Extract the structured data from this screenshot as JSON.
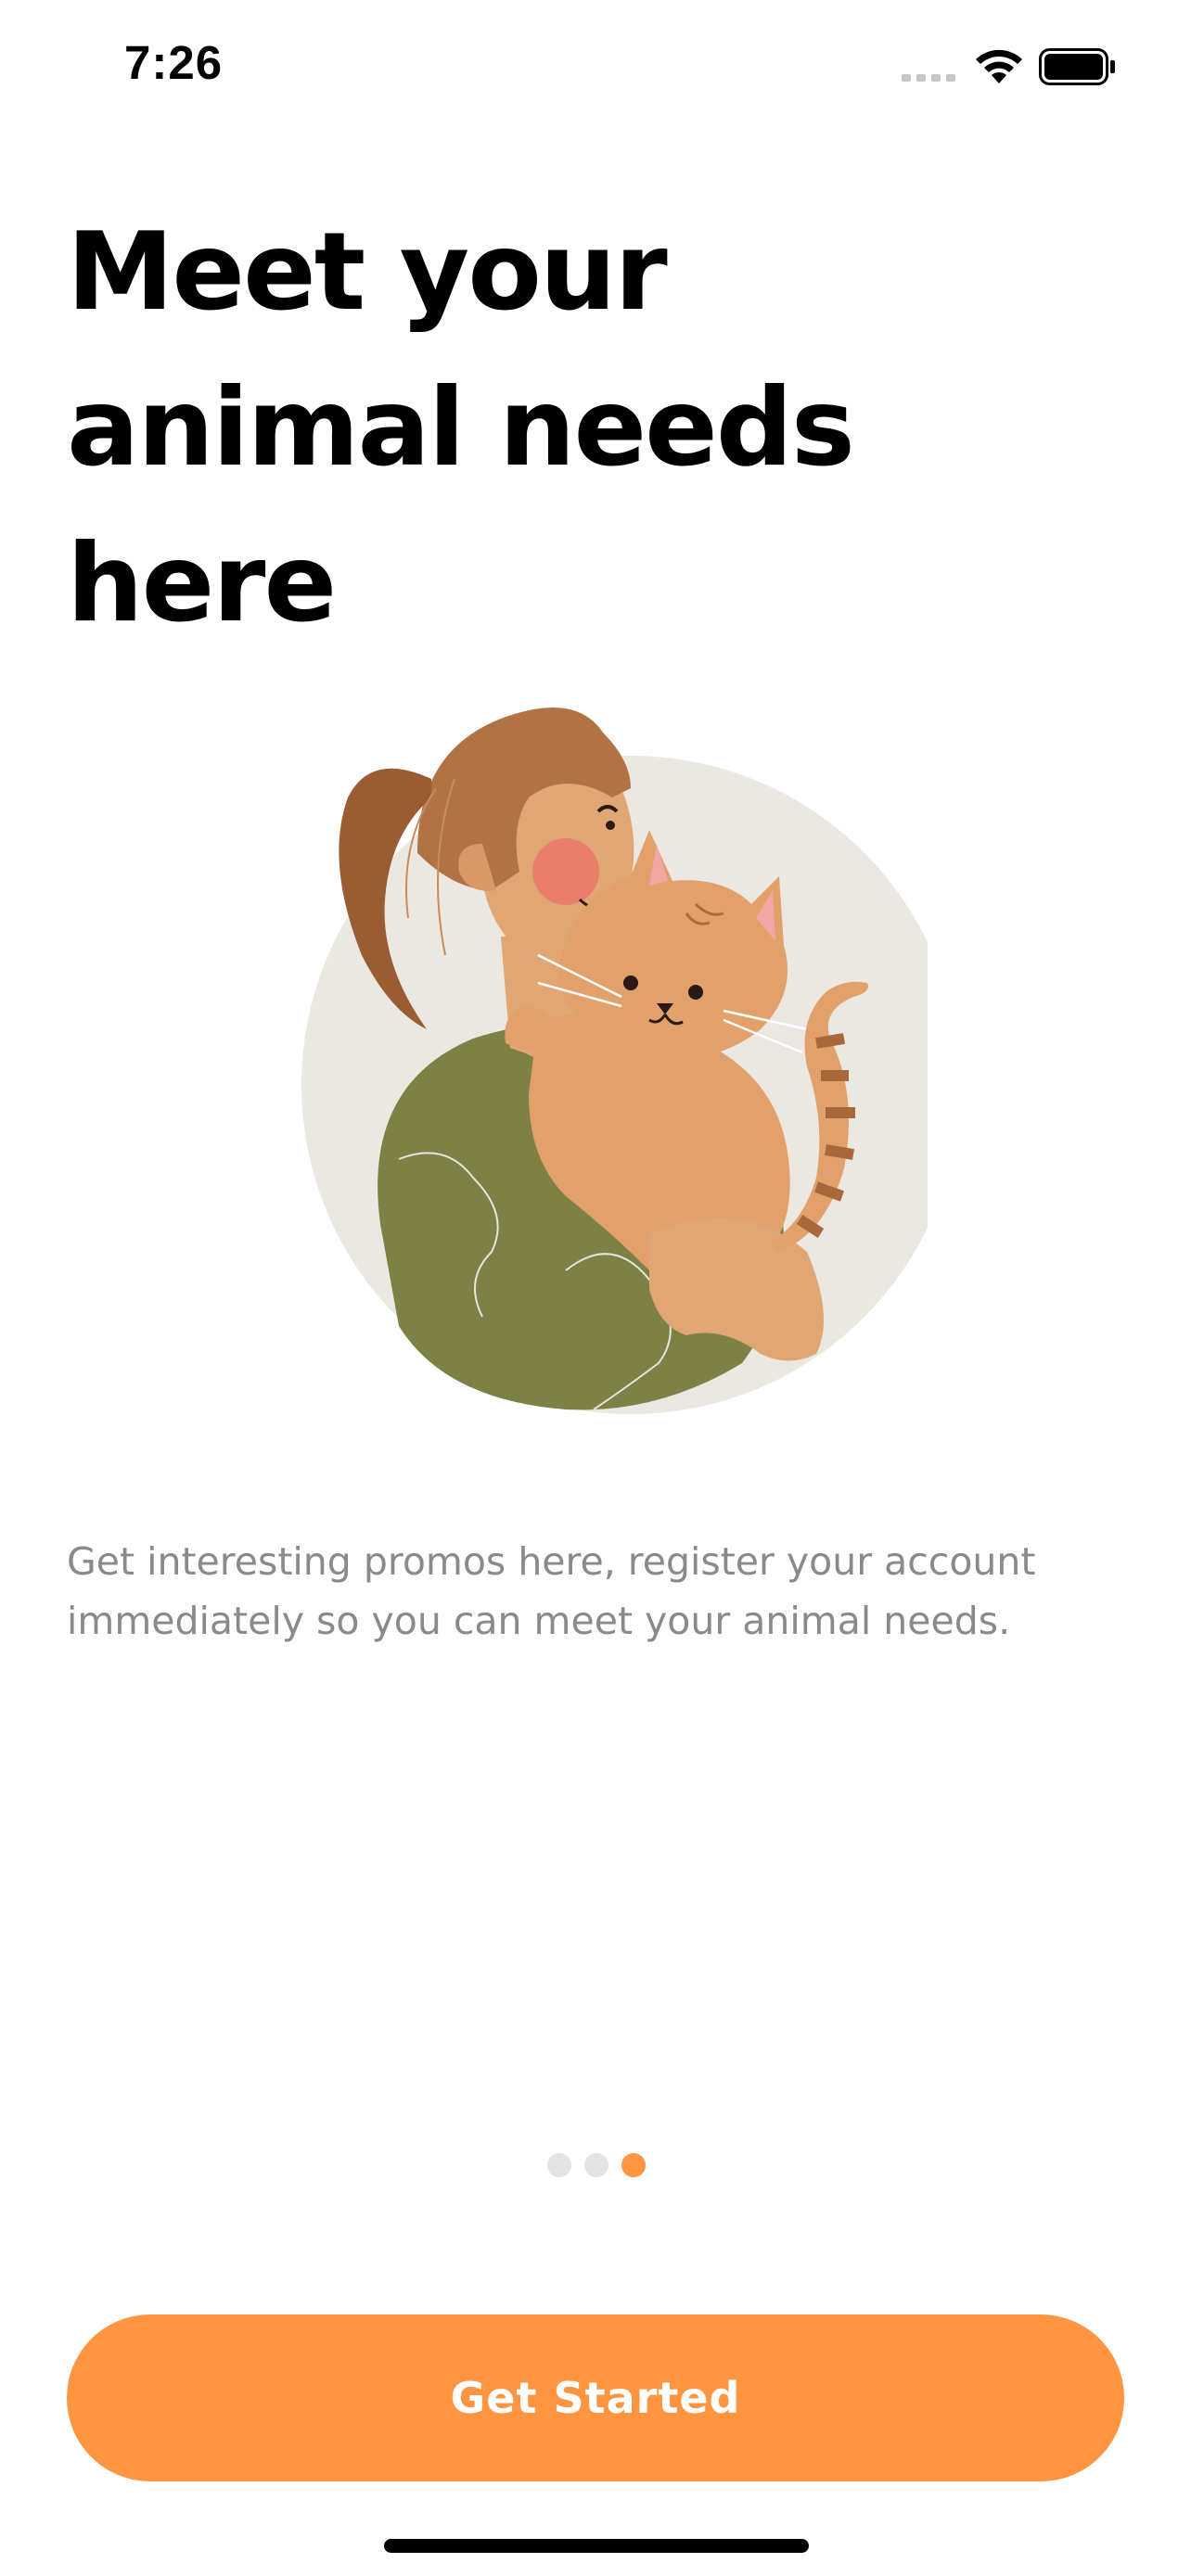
{
  "status_bar": {
    "time": "7:26"
  },
  "onboarding": {
    "headline_line1": "Meet your",
    "headline_line2": "animal needs",
    "headline_line3": "here",
    "description": "Get interesting promos here, register your account immediately so you can meet your animal needs.",
    "pager": {
      "total": 3,
      "active_index": 2
    },
    "cta_label": "Get Started"
  },
  "colors": {
    "accent": "#ff9441",
    "text_primary": "#000000",
    "text_secondary": "#8a8a8a",
    "dot_inactive": "#e3e3e3"
  },
  "icons": {
    "signal": "signal-icon",
    "wifi": "wifi-icon",
    "battery": "battery-icon"
  }
}
